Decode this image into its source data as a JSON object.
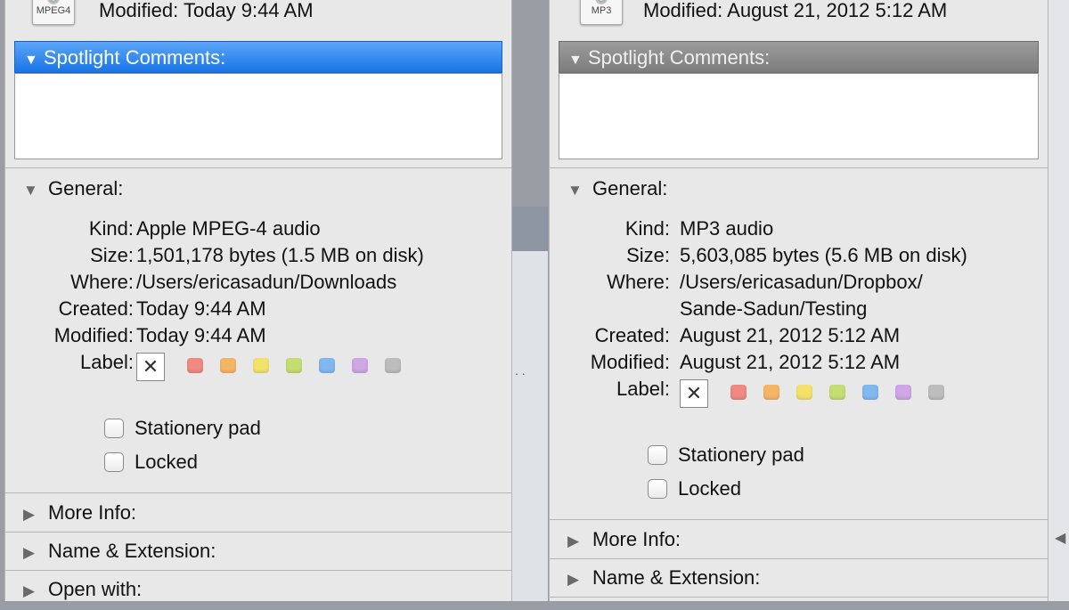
{
  "panels": [
    {
      "icon_label": "MPEG4",
      "modified_top": "Modified: Today 9:44 AM",
      "spotlight_header": "Spotlight Comments:",
      "general_header": "General:",
      "props": {
        "kind_label": "Kind:",
        "kind": "Apple MPEG-4 audio",
        "size_label": "Size:",
        "size": "1,501,178 bytes (1.5 MB on disk)",
        "where_label": "Where:",
        "where": "/Users/ericasadun/Downloads",
        "created_label": "Created:",
        "created": "Today 9:44 AM",
        "modified_label": "Modified:",
        "modified": "Today 9:44 AM",
        "label_label": "Label:"
      },
      "stationery": "Stationery pad",
      "locked": "Locked",
      "more_info": "More Info:",
      "name_ext": "Name & Extension:",
      "open_with": "Open with:"
    },
    {
      "icon_label": "MP3",
      "modified_top": "Modified: August 21, 2012 5:12 AM",
      "spotlight_header": "Spotlight Comments:",
      "general_header": "General:",
      "props": {
        "kind_label": "Kind:",
        "kind": "MP3 audio",
        "size_label": "Size:",
        "size": "5,603,085 bytes (5.6 MB on disk)",
        "where_label": "Where:",
        "where_line1": "/Users/ericasadun/Dropbox/",
        "where_line2": "Sande-Sadun/Testing",
        "created_label": "Created:",
        "created": "August 21, 2012 5:12 AM",
        "modified_label": "Modified:",
        "modified": "August 21, 2012 5:12 AM",
        "label_label": "Label:"
      },
      "stationery": "Stationery pad",
      "locked": "Locked",
      "more_info": "More Info:",
      "name_ext": "Name & Extension:"
    }
  ],
  "label_colors": [
    "#f08a80",
    "#f5b566",
    "#f3e26a",
    "#c4de72",
    "#82b8f0",
    "#cfa6e6",
    "#bdbdbd"
  ],
  "collapsed_icon": "disclosure-right-icon",
  "expanded_icon": "disclosure-down-icon",
  "colors": {
    "active_header": "#1a74e6",
    "inactive_header": "#8a8a8a"
  }
}
